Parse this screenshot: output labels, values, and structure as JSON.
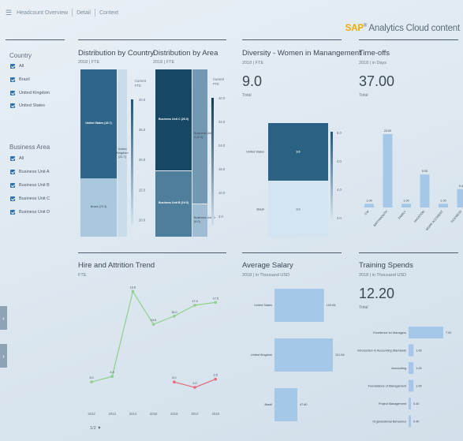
{
  "topbar": {
    "tabs": [
      "Headcount Overview",
      "Detail",
      "Context"
    ]
  },
  "brand": {
    "sap": "SAP",
    "reg": "®",
    "rest": " Analytics Cloud content"
  },
  "filters": {
    "country": {
      "title": "Country",
      "items": [
        "All",
        "Brazil",
        "United Kingdom",
        "United States"
      ]
    },
    "area": {
      "title": "Business Area",
      "items": [
        "All",
        "Business Unit A",
        "Business Unit B",
        "Business Unit C",
        "Business Unit D"
      ]
    }
  },
  "nav": {
    "prev": "‹",
    "next": "›"
  },
  "panels": {
    "country": {
      "title": "Distribution by Country",
      "sub": "2018 | FTE",
      "legend_title": "Current FTE"
    },
    "area": {
      "title": "Distribution by Area",
      "sub": "2018 | FTE",
      "legend_title": "Current FTE"
    },
    "diversity": {
      "title": "Diversity - Women in Manangement",
      "sub": "2018 | FTE",
      "big": "9.0",
      "total": "Total"
    },
    "timeoffs": {
      "title": "Time-offs",
      "sub": "2018 | in Days",
      "big": "37.00",
      "total": "Total"
    },
    "hire": {
      "title": "Hire and Attrition Trend",
      "sub": "FTE",
      "pager": "1/2 ▼"
    },
    "salary": {
      "title": "Average Salary",
      "sub": "2018 | in Thousand USD"
    },
    "training": {
      "title": "Training Spends",
      "sub": "2018 | in Thousand USD",
      "big": "12.20",
      "total": "Total"
    }
  },
  "chart_data": [
    {
      "type": "heatmap",
      "name": "country",
      "cells": [
        {
          "label": "United States (43.7)",
          "value": 43.7
        },
        {
          "label": "Brazil (23.3)",
          "value": 23.3
        },
        {
          "label": "United Kingdom (22.7)",
          "value": 22.7
        }
      ],
      "legend_ticks": [
        "40.0",
        "35.0",
        "30.0",
        "25.0",
        "20.0"
      ]
    },
    {
      "type": "heatmap",
      "name": "area",
      "cells": [
        {
          "label": "Business Unit C (26.0)",
          "value": 26.0
        },
        {
          "label": "Business Unit B (19.0)",
          "value": 19.0
        },
        {
          "label": "Business Unit A (6.0)",
          "value": 6.0
        },
        {
          "label": "Business Unit D (6.0)",
          "value": 6.0
        }
      ],
      "legend_ticks": [
        "40.0",
        "32.0",
        "24.0",
        "16.0",
        "10.0",
        "3.0"
      ]
    },
    {
      "type": "heatmap",
      "name": "diversity",
      "rows": [
        "United States",
        "Brazil"
      ],
      "values": [
        3.0,
        3.0
      ],
      "legend_ticks": [
        "6.0",
        "4.0",
        "4.0",
        "2.0"
      ]
    },
    {
      "type": "bar",
      "name": "timeoffs",
      "categories": [
        "CW",
        "BIRTHMONTH",
        "FAMILY",
        "VACATION",
        "WORK ACCIDENT",
        "SICKNESS"
      ],
      "values": [
        1.0,
        20.0,
        1.0,
        9.0,
        1.0,
        5.0
      ],
      "value_labels": [
        "1.00",
        "20.00",
        "1.00",
        "9.00",
        "1.00",
        "5.00"
      ]
    },
    {
      "type": "line",
      "name": "hire",
      "x": [
        "2012",
        "2013",
        "2014",
        "2015",
        "2016",
        "2017",
        "2018"
      ],
      "series": [
        {
          "color": "#8fd18a",
          "values": [
            3.0,
            4.0,
            19.5,
            13.5,
            15.0,
            17.0,
            17.5
          ],
          "labels": [
            "3.0",
            "4.0",
            "19.5",
            "13.5",
            "15.0",
            "17.0",
            "17.5"
          ]
        },
        {
          "color": "#e36b7a",
          "values": [
            null,
            null,
            null,
            null,
            3.0,
            2.0,
            3.5
          ],
          "labels": [
            "",
            "",
            "",
            "",
            "3.0",
            "2.0",
            "3.5"
          ]
        }
      ]
    },
    {
      "type": "bar",
      "name": "salary",
      "categories": [
        "United States",
        "United Kingdom",
        "Brazil"
      ],
      "values": [
        103.0,
        121.5,
        47.6
      ],
      "value_labels": [
        "103.06",
        "121.54",
        "47.60"
      ]
    },
    {
      "type": "bar",
      "name": "training",
      "categories": [
        "Excellence for Managers",
        "Introduction to Accounting Standards",
        "Accounting",
        "Foundations of Management",
        "Project Management",
        "Organizational Behaviour"
      ],
      "values": [
        7.0,
        1.0,
        1.0,
        1.0,
        0.4,
        0.4
      ],
      "value_labels": [
        "7.00",
        "1.00",
        "1.00",
        "1.00",
        "0.40",
        "0.40"
      ]
    }
  ]
}
